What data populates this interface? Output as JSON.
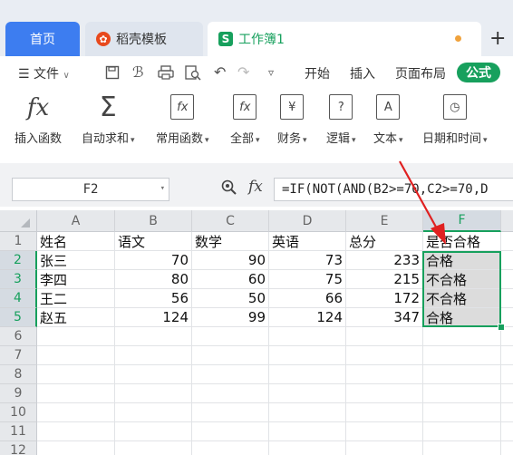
{
  "tabs": {
    "home": "首页",
    "docer": "稻壳模板",
    "docer_icon": "docer-logo-icon",
    "workbook": "工作簿1",
    "workbook_icon": "S",
    "add": "+"
  },
  "menu": {
    "file": "文件",
    "items": [
      "开始",
      "插入",
      "页面布局"
    ],
    "active": "公式"
  },
  "ribbon": {
    "items": [
      {
        "label": "插入函数",
        "icon": "fx"
      },
      {
        "label": "自动求和",
        "icon": "Σ"
      },
      {
        "label": "常用函数",
        "icon": "fx"
      },
      {
        "label": "全部",
        "icon": "fx"
      },
      {
        "label": "财务",
        "icon": "¥"
      },
      {
        "label": "逻辑",
        "icon": "?"
      },
      {
        "label": "文本",
        "icon": "A"
      },
      {
        "label": "日期和时间",
        "icon": "◷"
      }
    ]
  },
  "formula_bar": {
    "name_box": "F2",
    "fx": "fx",
    "formula": "=IF(NOT(AND(B2>=70,C2>=70,D"
  },
  "sheet": {
    "columns": [
      "A",
      "B",
      "C",
      "D",
      "E",
      "F"
    ],
    "row_numbers": [
      "1",
      "2",
      "3",
      "4",
      "5",
      "6",
      "7",
      "8",
      "9",
      "10",
      "11",
      "12"
    ],
    "rows": [
      [
        "姓名",
        "语文",
        "数学",
        "英语",
        "总分",
        "是否合格"
      ],
      [
        "张三",
        "70",
        "90",
        "73",
        "233",
        "合格"
      ],
      [
        "李四",
        "80",
        "60",
        "75",
        "215",
        "不合格"
      ],
      [
        "王二",
        "56",
        "50",
        "66",
        "172",
        "不合格"
      ],
      [
        "赵五",
        "124",
        "99",
        "124",
        "347",
        "合格"
      ]
    ]
  },
  "colors": {
    "accent_green": "#17a05d",
    "tab_blue": "#3d7df0",
    "arrow_red": "#e02020"
  }
}
